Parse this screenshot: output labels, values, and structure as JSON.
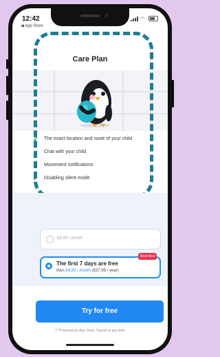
{
  "status_bar": {
    "time": "12:42",
    "back_label": "◀ App Store"
  },
  "header": {
    "title": "Care Plan"
  },
  "features": [
    {
      "text": "The exact location and route of your child"
    },
    {
      "text": "Chat with your child"
    },
    {
      "text": "Movement notifications"
    },
    {
      "text": "Disabling silent mode"
    }
  ],
  "plans": {
    "monthly": {
      "price": "£6.99 / month"
    },
    "trial": {
      "title": "The first 7 days are free",
      "detail_prefix": "then ",
      "detail_price": "£4.83 / month",
      "detail_suffix": " (£57.99 / year)",
      "badge": "Best deal"
    }
  },
  "cta": {
    "label": "Try for free"
  },
  "footer": {
    "text": "Protected by App Store. Cancel at any time"
  },
  "colors": {
    "accent": "#2188f2",
    "check": "#36a84a",
    "badge": "#e8334f",
    "dash": "#1e7c95"
  }
}
